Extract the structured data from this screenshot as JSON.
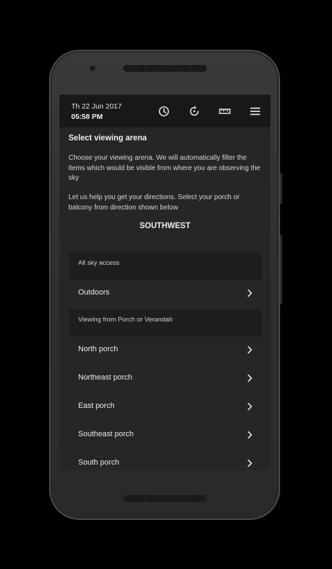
{
  "status": {
    "date": "Th 22 Jun 2017",
    "time": "05:58 PM",
    "icons": [
      "clock-icon",
      "refresh-icon",
      "ruler-icon",
      "menu-icon"
    ]
  },
  "page": {
    "title": "Select viewing arena",
    "intro": "Choose your viewing arena. We will automatically filter the items which would be visible from where you are observing the sky",
    "help": "Let us help you get your directions. Select your porch or balcony from direction shown below",
    "direction": "SOUTHWEST"
  },
  "sections": [
    {
      "header": "All sky access",
      "items": [
        {
          "label": "Outdoors"
        }
      ]
    },
    {
      "header": "Viewing from Porch or Verandah",
      "items": [
        {
          "label": "North porch"
        },
        {
          "label": "Northeast porch"
        },
        {
          "label": "East porch"
        },
        {
          "label": "Southeast porch"
        },
        {
          "label": "South porch"
        }
      ]
    }
  ],
  "colors": {
    "screen_bg": "#262626",
    "statusbar_bg": "#181818",
    "section_bg": "#1e1e1e",
    "text": "#ececec"
  }
}
